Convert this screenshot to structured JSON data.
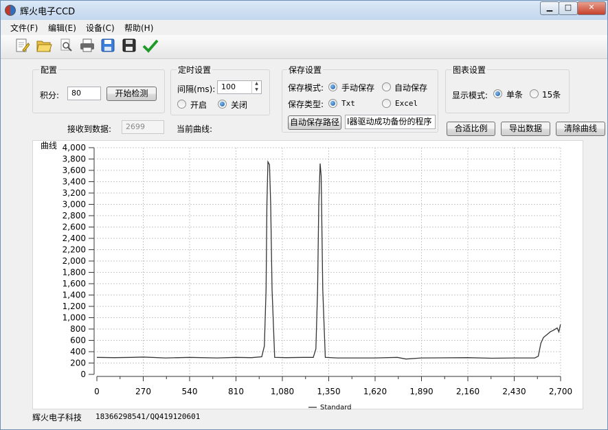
{
  "window": {
    "title": "辉火电子CCD",
    "controls": {
      "minimize": "▁",
      "maximize": "□",
      "close": "✕"
    }
  },
  "menu": [
    {
      "label": "文件(F)"
    },
    {
      "label": "编辑(E)"
    },
    {
      "label": "设备(C)"
    },
    {
      "label": "帮助(H)"
    }
  ],
  "toolbar": [
    {
      "icon": "new-document-icon"
    },
    {
      "icon": "open-folder-icon"
    },
    {
      "icon": "print-preview-icon"
    },
    {
      "icon": "print-icon"
    },
    {
      "icon": "save-as-icon"
    },
    {
      "icon": "save-icon"
    },
    {
      "icon": "checkmark-icon"
    }
  ],
  "config": {
    "title": "配置",
    "integration_label": "积分:",
    "integration_value": "80",
    "start_button": "开始检测",
    "received_label": "接收到数据:",
    "received_value": "2699"
  },
  "timer": {
    "title": "定时设置",
    "interval_label": "间隔(ms):",
    "interval_value": "100",
    "on_label": "开启",
    "off_label": "关闭",
    "selected": "off",
    "current_curve_label": "当前曲线:"
  },
  "save": {
    "title": "保存设置",
    "mode_label": "保存模式:",
    "manual_label": "手动保存",
    "auto_label": "自动保存",
    "type_label": "保存类型:",
    "txt_label": "Txt",
    "excel_label": "Excel",
    "path_button": "自动保存路径",
    "path_value": "I器驱动成功备份的程序"
  },
  "chart_settings": {
    "title": "图表设置",
    "mode_label": "显示模式:",
    "single_label": "单条",
    "fifteen_label": "15条",
    "fit_button": "合适比例",
    "export_button": "导出数据",
    "clear_button": "清除曲线"
  },
  "chart_data": {
    "type": "line",
    "title": "曲线",
    "xlim": [
      0,
      2700
    ],
    "ylim": [
      0,
      4000
    ],
    "x_ticks": [
      "0",
      "270",
      "540",
      "810",
      "1,080",
      "1,350",
      "1,620",
      "1,890",
      "2,160",
      "2,430",
      "2,700"
    ],
    "y_ticks": [
      "0",
      "200",
      "400",
      "600",
      "800",
      "1,000",
      "1,200",
      "1,400",
      "1,600",
      "1,800",
      "2,000",
      "2,200",
      "2,400",
      "2,600",
      "2,800",
      "3,000",
      "3,200",
      "3,400",
      "3,600",
      "3,800",
      "4,000"
    ],
    "grid": true,
    "legend_position": "bottom",
    "series": [
      {
        "name": "Standard",
        "color": "#333333",
        "x": [
          0,
          100,
          200,
          270,
          400,
          540,
          700,
          810,
          900,
          960,
          975,
          985,
          990,
          996,
          1005,
          1012,
          1020,
          1035,
          1100,
          1200,
          1260,
          1275,
          1285,
          1292,
          1300,
          1306,
          1315,
          1330,
          1400,
          1620,
          1750,
          1800,
          1890,
          2160,
          2300,
          2430,
          2550,
          2570,
          2585,
          2600,
          2620,
          2640,
          2660,
          2680,
          2690,
          2699
        ],
        "y": [
          300,
          295,
          300,
          305,
          290,
          300,
          290,
          300,
          295,
          310,
          500,
          1500,
          3000,
          3750,
          3700,
          3000,
          1500,
          300,
          295,
          300,
          300,
          450,
          1500,
          3000,
          3720,
          3500,
          1500,
          300,
          290,
          290,
          300,
          270,
          290,
          295,
          285,
          290,
          290,
          320,
          550,
          650,
          700,
          750,
          780,
          820,
          750,
          880
        ]
      }
    ]
  },
  "status": {
    "company": "辉火电子科技",
    "contact": "18366298541/QQ419120601"
  }
}
